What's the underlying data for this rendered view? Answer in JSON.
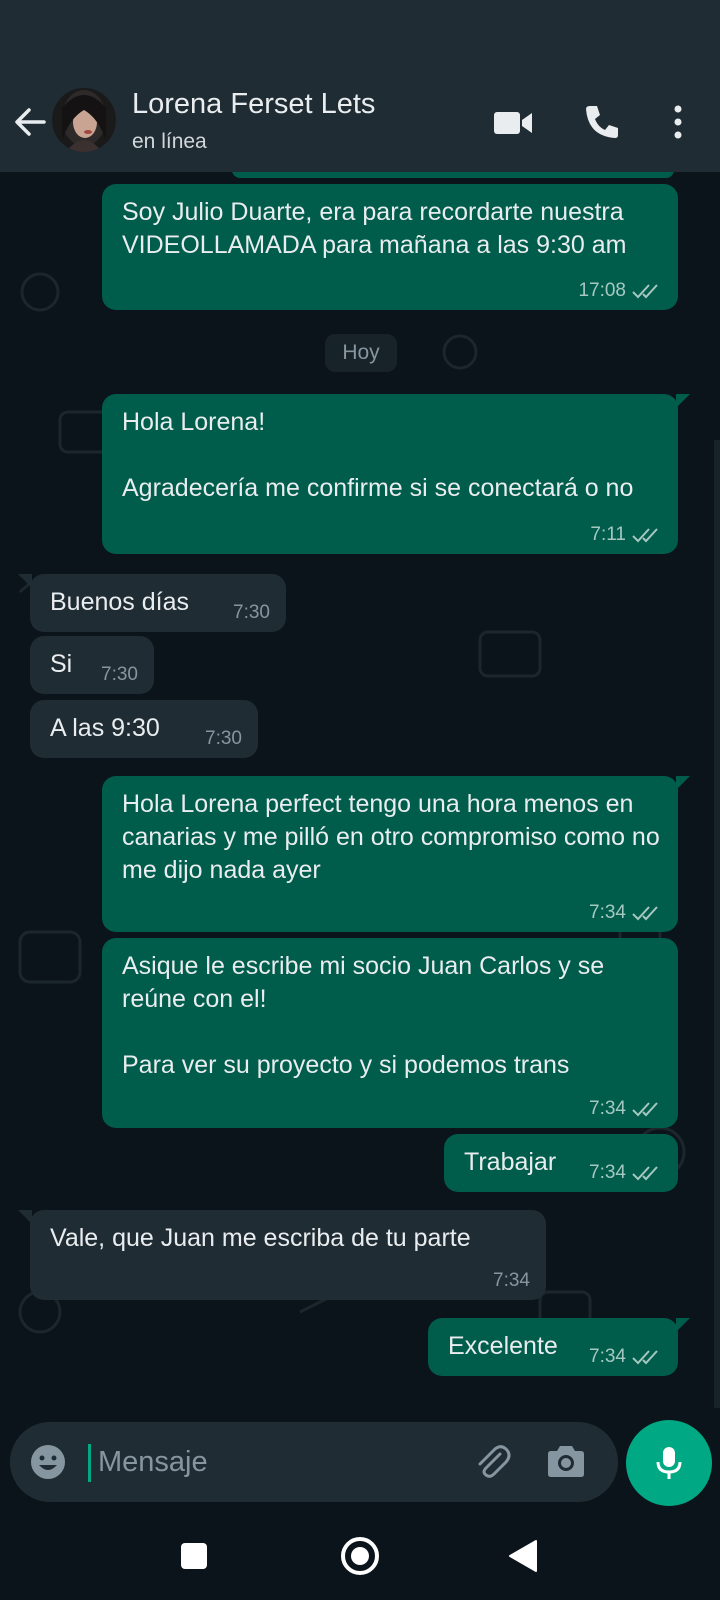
{
  "header": {
    "contact_name": "Lorena Ferset Lets",
    "contact_status": "en línea",
    "back_icon": "arrow-left-icon",
    "video_icon": "video-camera-icon",
    "call_icon": "phone-icon",
    "menu_icon": "more-vertical-icon"
  },
  "chat": {
    "date_separator": "Hoy",
    "messages": [
      {
        "direction": "out",
        "text": "Soy Julio Duarte, era para recordarte nuestra VIDEOLLAMADA para mañana a las 9:30 am",
        "time": "17:08",
        "status": "read-double-tick"
      },
      {
        "direction": "out",
        "text": "Hola Lorena!\n\nAgradecería me confirme si se conectará o no",
        "time": "7:11",
        "status": "read-double-tick"
      },
      {
        "direction": "in",
        "text": "Buenos días",
        "time": "7:30"
      },
      {
        "direction": "in",
        "text": "Si",
        "time": "7:30"
      },
      {
        "direction": "in",
        "text": "A las 9:30",
        "time": "7:30"
      },
      {
        "direction": "out",
        "text": "Hola Lorena perfect tengo una hora menos en canarias y me pilló en otro compromiso como no me dijo nada ayer",
        "time": "7:34",
        "status": "read-double-tick"
      },
      {
        "direction": "out",
        "text": "Asique le escribe mi socio Juan Carlos y se reúne con el!\n\nPara ver su proyecto y si podemos trans",
        "time": "7:34",
        "status": "read-double-tick"
      },
      {
        "direction": "out",
        "text": "Trabajar",
        "time": "7:34",
        "status": "read-double-tick"
      },
      {
        "direction": "in",
        "text": "Vale, que Juan me escriba de tu parte",
        "time": "7:34"
      },
      {
        "direction": "out",
        "text": "Excelente",
        "time": "7:34",
        "status": "read-double-tick"
      }
    ]
  },
  "composer": {
    "placeholder": "Mensaje",
    "value": "",
    "emoji_icon": "emoji-icon",
    "attach_icon": "paperclip-icon",
    "camera_icon": "camera-icon",
    "mic_icon": "microphone-icon"
  },
  "navbar": {
    "recents_icon": "square-icon",
    "home_icon": "circle-icon",
    "back_icon": "triangle-back-icon"
  },
  "colors": {
    "header_bg": "#202c33",
    "chat_bg": "#0b141a",
    "outgoing_bubble": "#005c4b",
    "incoming_bubble": "#202c33",
    "accent": "#00a884",
    "primary_text": "#e9edef",
    "secondary_text": "#8696a0"
  }
}
